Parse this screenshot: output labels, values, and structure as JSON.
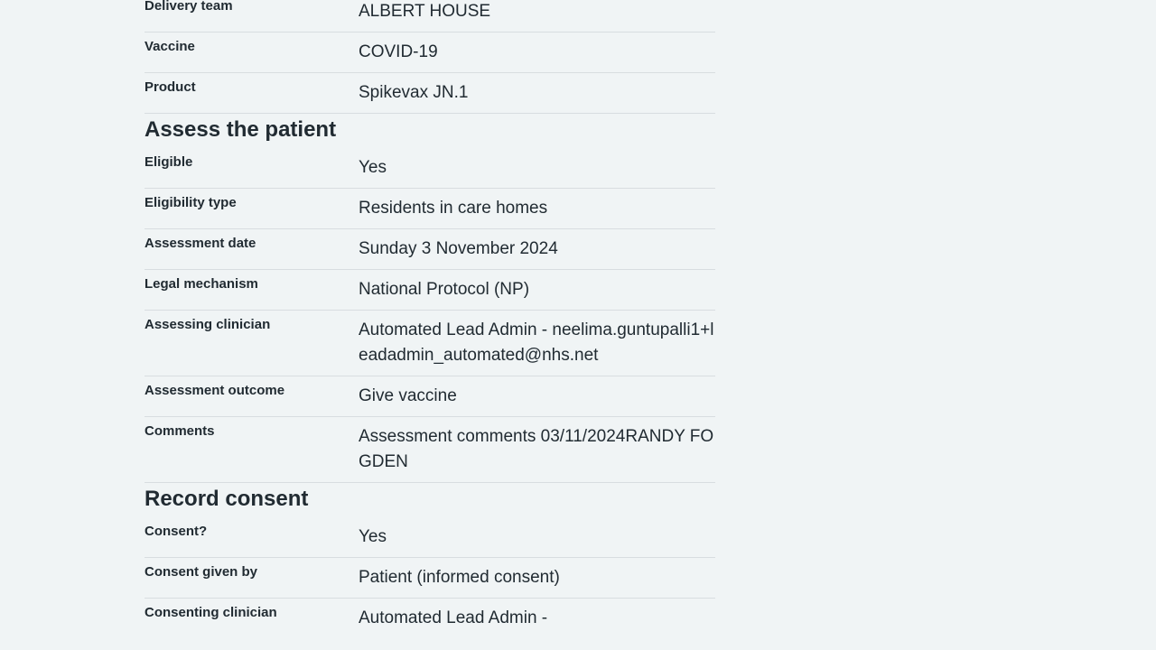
{
  "sections": [
    {
      "heading": "",
      "rows": [
        {
          "key": "Delivery team",
          "value": "ALBERT HOUSE"
        },
        {
          "key": "Vaccine",
          "value": "COVID-19"
        },
        {
          "key": "Product",
          "value": "Spikevax JN.1"
        }
      ]
    },
    {
      "heading": "Assess the patient",
      "rows": [
        {
          "key": "Eligible",
          "value": "Yes"
        },
        {
          "key": "Eligibility type",
          "value": "Residents in care homes"
        },
        {
          "key": "Assessment date",
          "value": "Sunday 3 November 2024"
        },
        {
          "key": "Legal mechanism",
          "value": "National Protocol (NP)"
        },
        {
          "key": "Assessing clinician",
          "value": "Automated Lead Admin - neelima.guntupalli1+leadadmin_automated@nhs.net"
        },
        {
          "key": "Assessment outcome",
          "value": "Give vaccine"
        },
        {
          "key": "Comments",
          "value": "Assessment comments 03/11/2024RANDY FOGDEN"
        }
      ]
    },
    {
      "heading": "Record consent",
      "rows": [
        {
          "key": "Consent?",
          "value": "Yes"
        },
        {
          "key": "Consent given by",
          "value": "Patient (informed consent)"
        },
        {
          "key": "Consenting clinician",
          "value": "Automated Lead Admin -"
        }
      ]
    }
  ]
}
